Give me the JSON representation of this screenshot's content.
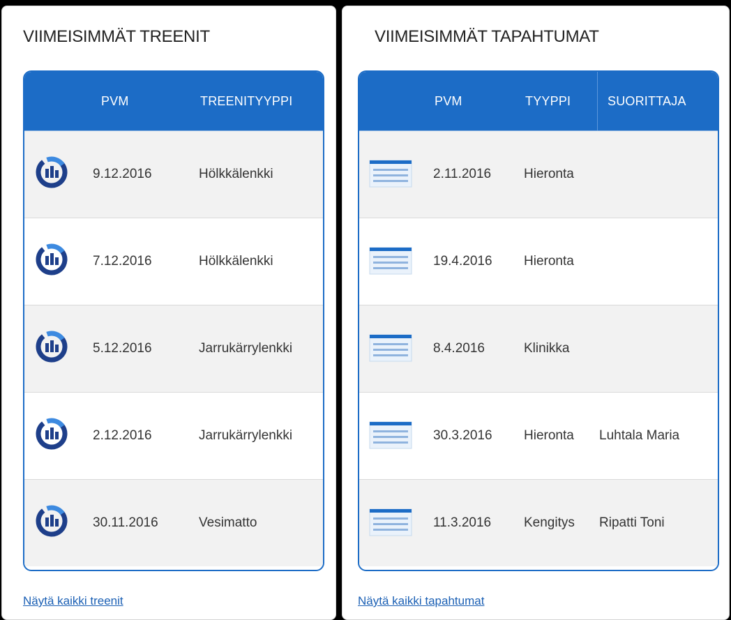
{
  "workouts": {
    "title": "VIIMEISIMMÄT TREENIT",
    "headers": {
      "date": "PVM",
      "type": "TREENITYYPPI"
    },
    "rows": [
      {
        "date": "9.12.2016",
        "type": "Hölkkälenkki"
      },
      {
        "date": "7.12.2016",
        "type": "Hölkkälenkki"
      },
      {
        "date": "5.12.2016",
        "type": "Jarrukärrylenkki"
      },
      {
        "date": "2.12.2016",
        "type": "Jarrukärrylenkki"
      },
      {
        "date": "30.11.2016",
        "type": "Vesimatto"
      }
    ],
    "link": "Näytä kaikki treenit",
    "row_icon": "chart-gauge-icon"
  },
  "events": {
    "title": "VIIMEISIMMÄT TAPAHTUMAT",
    "headers": {
      "date": "PVM",
      "type": "TYYPPI",
      "performer": "SUORITTAJA"
    },
    "rows": [
      {
        "date": "2.11.2016",
        "type": "Hieronta",
        "performer": ""
      },
      {
        "date": "19.4.2016",
        "type": "Hieronta",
        "performer": ""
      },
      {
        "date": "8.4.2016",
        "type": "Klinikka",
        "performer": ""
      },
      {
        "date": "30.3.2016",
        "type": "Hieronta",
        "performer": "Luhtala Maria"
      },
      {
        "date": "11.3.2016",
        "type": "Kengitys",
        "performer": "Ripatti Toni"
      }
    ],
    "link": "Näytä kaikki tapahtumat",
    "row_icon": "list-icon"
  },
  "colors": {
    "accent": "#1c6cc6",
    "icon_dark": "#1e3f8a",
    "link": "#1a5fb4"
  }
}
